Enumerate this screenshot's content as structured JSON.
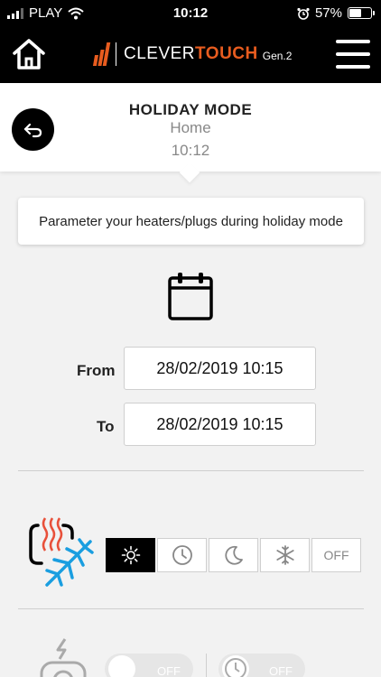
{
  "status_bar": {
    "carrier": "PLAY",
    "time": "10:12",
    "battery": "57%",
    "battery_level": 0.57
  },
  "app_bar": {
    "logo_text_plain": "CLEVER",
    "logo_text_bold": "TOUCH",
    "logo_gen": "Gen.2"
  },
  "title_panel": {
    "mode": "HOLIDAY MODE",
    "place": "Home",
    "time": "10:12"
  },
  "info": {
    "text": "Parameter your heaters/plugs during holiday mode"
  },
  "schedule": {
    "from_label": "From",
    "from_value": "28/02/2019 10:15",
    "to_label": "To",
    "to_value": "28/02/2019 10:15"
  },
  "modes": {
    "selected": "comfort",
    "off_label": "OFF"
  },
  "plug": {
    "toggle1_label": "OFF",
    "toggle2_label": "OFF"
  },
  "colors": {
    "brand_orange": "#e85c1f",
    "heat_red": "#e8503a",
    "frost_blue": "#1a9ee0"
  }
}
